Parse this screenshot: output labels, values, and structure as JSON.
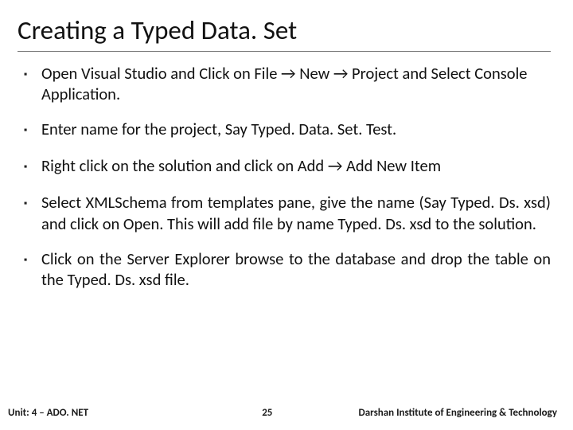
{
  "title": "Creating a Typed Data. Set",
  "bullets": [
    {
      "text": "Open Visual Studio and Click on File → New → Project and Select Console Application.",
      "justify": false
    },
    {
      "text": "Enter name for the project, Say Typed. Data. Set. Test.",
      "justify": false
    },
    {
      "text": "Right click on the solution and click on Add → Add New Item",
      "justify": false
    },
    {
      "text": "Select XMLSchema from templates pane, give the name (Say Typed. Ds. xsd) and click on Open. This will add file by name Typed. Ds. xsd to the solution.",
      "justify": true
    },
    {
      "text": "Click on the Server Explorer browse to the database and drop the table on the Typed. Ds. xsd file.",
      "justify": true
    }
  ],
  "footer": {
    "left": "Unit: 4 – ADO. NET",
    "center": "25",
    "right": "Darshan Institute of Engineering & Technology"
  }
}
